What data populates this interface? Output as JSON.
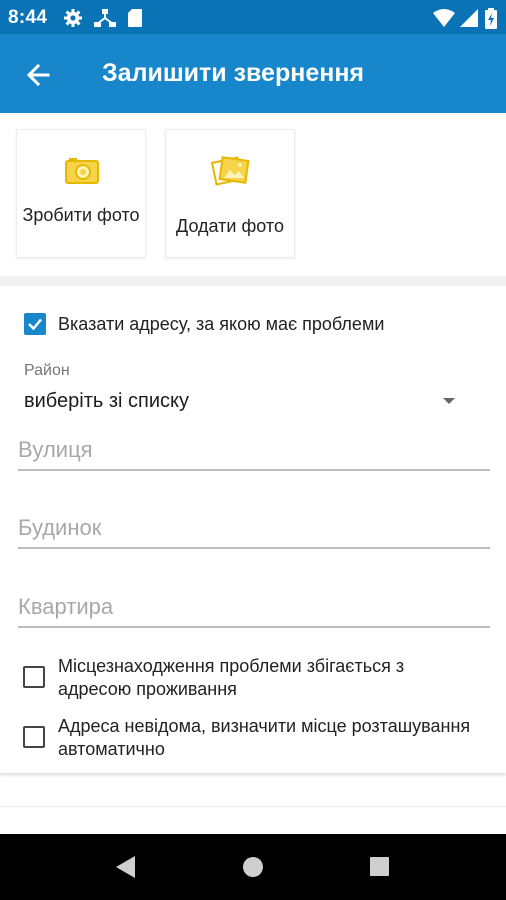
{
  "status_bar": {
    "time": "8:44",
    "icons": [
      "gear-icon",
      "network-transfer-icon",
      "sd-card-icon",
      "wifi-icon",
      "cell-signal-icon",
      "battery-charging-icon"
    ]
  },
  "app_bar": {
    "back_icon": "arrow-left-icon",
    "title": "Залишити звернення"
  },
  "photo_actions": {
    "take_photo": {
      "icon": "camera-icon",
      "label": "Зробити фото"
    },
    "add_photo": {
      "icon": "photos-icon",
      "label": "Додати фото"
    }
  },
  "address": {
    "specify_address": {
      "label": "Вказати адресу, за якою має проблеми",
      "checked": true
    },
    "district_label": "Район",
    "district_value": "виберіть зі списку",
    "street_placeholder": "Вулиця",
    "house_placeholder": "Будинок",
    "apartment_placeholder": "Квартира",
    "same_as_residence": {
      "label": "Місцезнаходження проблеми збігається з адресою проживання",
      "checked": false
    },
    "unknown_address": {
      "label": "Адреса невідома, визначити місце розташування автоматично",
      "checked": false
    }
  },
  "colors": {
    "status_bar": "#0a73b5",
    "app_bar": "#1786cb",
    "accent_yellow": "#f2c40f",
    "checkbox_accent": "#1786cb"
  },
  "nav_bar": {
    "buttons": [
      "back-triangle-icon",
      "home-circle-icon",
      "recents-square-icon"
    ]
  }
}
